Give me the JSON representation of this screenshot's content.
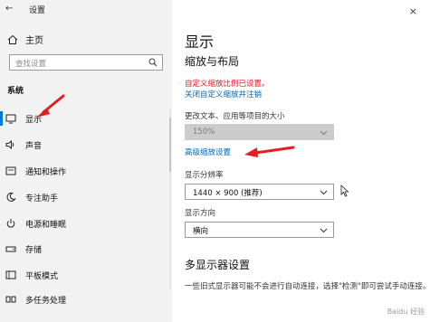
{
  "window": {
    "title": "设置",
    "back_glyph": "←",
    "close_glyph": "×"
  },
  "sidebar": {
    "home_label": "主页",
    "search_placeholder": "查找设置",
    "section_title": "系统",
    "items": [
      {
        "label": "显示",
        "icon": "monitor-icon",
        "selected": true
      },
      {
        "label": "声音",
        "icon": "speaker-icon"
      },
      {
        "label": "通知和操作",
        "icon": "notification-icon"
      },
      {
        "label": "专注助手",
        "icon": "moon-icon"
      },
      {
        "label": "电源和睡眠",
        "icon": "power-icon"
      },
      {
        "label": "存储",
        "icon": "storage-icon"
      },
      {
        "label": "平板模式",
        "icon": "tablet-icon"
      },
      {
        "label": "多任务处理",
        "icon": "multitask-icon"
      }
    ]
  },
  "main": {
    "page_title": "显示",
    "section_scale": "缩放与布局",
    "warning_text": "自定义缩放比例已设置。",
    "turn_off_link": "关闭自定义缩放并注销",
    "scale_label": "更改文本、应用等项目的大小",
    "scale_value": "150%",
    "advanced_link": "高级缩放设置",
    "resolution_label": "显示分辨率",
    "resolution_value": "1440 × 900 (推荐)",
    "orientation_label": "显示方向",
    "orientation_value": "横向",
    "multi_title": "多显示器设置",
    "multi_desc": "一些旧式显示器可能不会进行自动连接，选择\"检测\"即可尝试手动连接。"
  },
  "watermark": "Baidu 经验"
}
